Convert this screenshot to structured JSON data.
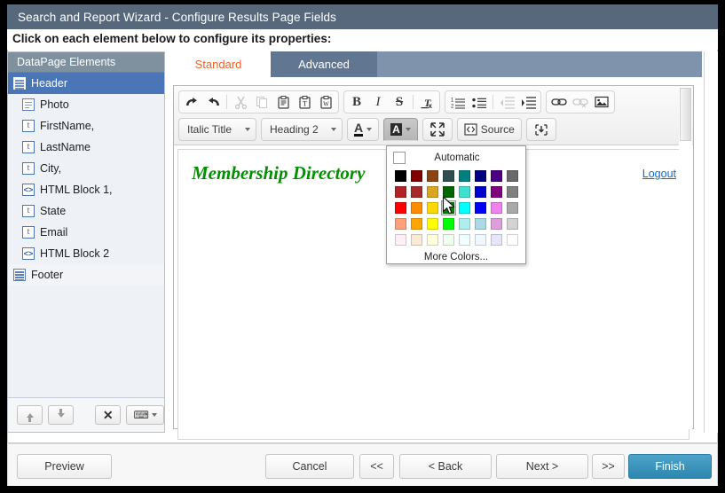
{
  "window": {
    "title": "Search and Report Wizard - Configure Results Page Fields",
    "instruction": "Click on each element below to configure its properties:"
  },
  "sidebar": {
    "header": "DataPage Elements",
    "items": [
      {
        "label": "Header",
        "icon": "block-icon",
        "level": 1,
        "selected": true
      },
      {
        "label": "Photo",
        "icon": "document-icon",
        "level": 2,
        "selected": false
      },
      {
        "label": "FirstName,",
        "icon": "text-field-icon",
        "level": 2,
        "selected": false
      },
      {
        "label": "LastName",
        "icon": "text-field-icon",
        "level": 2,
        "selected": false
      },
      {
        "label": "City,",
        "icon": "text-field-icon",
        "level": 2,
        "selected": false
      },
      {
        "label": "HTML Block 1,",
        "icon": "html-block-icon",
        "level": 2,
        "selected": false
      },
      {
        "label": "State",
        "icon": "text-field-icon",
        "level": 2,
        "selected": false
      },
      {
        "label": "Email",
        "icon": "text-field-icon",
        "level": 2,
        "selected": false
      },
      {
        "label": "HTML Block 2",
        "icon": "html-block-icon",
        "level": 2,
        "selected": false
      },
      {
        "label": "Footer",
        "icon": "block-icon",
        "level": 1,
        "selected": false,
        "footer": true
      }
    ],
    "tools": [
      {
        "name": "move-up-button",
        "glyph": "up"
      },
      {
        "name": "move-down-button",
        "glyph": "down"
      },
      {
        "name": "delete-element-button",
        "glyph": "✕"
      },
      {
        "name": "insert-element-dropdown",
        "glyph": "insert"
      }
    ]
  },
  "tabs": [
    {
      "label": "Standard",
      "active": true
    },
    {
      "label": "Advanced",
      "active": false
    }
  ],
  "editor": {
    "toolbar_row1": [
      {
        "group": 1,
        "name": "undo-icon",
        "glyph": "↶",
        "disabled": false
      },
      {
        "group": 1,
        "name": "redo-icon",
        "glyph": "↷",
        "disabled": false
      },
      {
        "group": 1,
        "name": "separator",
        "glyph": "|",
        "disabled": false
      },
      {
        "group": 1,
        "name": "cut-icon",
        "glyph": "✂",
        "disabled": true
      },
      {
        "group": 1,
        "name": "copy-icon",
        "glyph": "❐",
        "disabled": true
      },
      {
        "group": 1,
        "name": "paste-icon",
        "glyph": "Ὄb",
        "disabled": false
      },
      {
        "group": 1,
        "name": "paste-as-text-icon",
        "glyph": "T",
        "disabled": false
      },
      {
        "group": 1,
        "name": "paste-from-word-icon",
        "glyph": "W",
        "disabled": false
      },
      {
        "group": 2,
        "name": "bold-icon",
        "glyph": "B",
        "disabled": false
      },
      {
        "group": 2,
        "name": "italic-icon",
        "glyph": "I",
        "disabled": false
      },
      {
        "group": 2,
        "name": "strikethrough-icon",
        "glyph": "S",
        "disabled": false
      },
      {
        "group": 2,
        "name": "remove-format-icon",
        "glyph": "Tx",
        "disabled": false
      },
      {
        "group": 3,
        "name": "numbered-list-icon",
        "glyph": "1≡",
        "disabled": false
      },
      {
        "group": 3,
        "name": "bulleted-list-icon",
        "glyph": "•≡",
        "disabled": false
      },
      {
        "group": 3,
        "name": "decrease-indent-icon",
        "glyph": "←≡",
        "disabled": true
      },
      {
        "group": 3,
        "name": "increase-indent-icon",
        "glyph": "→≡",
        "disabled": false
      },
      {
        "group": 4,
        "name": "link-icon",
        "glyph": "⚭",
        "disabled": false
      },
      {
        "group": 4,
        "name": "unlink-icon",
        "glyph": "⚭",
        "disabled": true
      },
      {
        "group": 4,
        "name": "image-icon",
        "glyph": "⛰",
        "disabled": false
      }
    ],
    "style_select": "Italic Title",
    "format_select": "Heading 2",
    "text_color_label": "A",
    "bg_color_label": "A",
    "maximize_label": "",
    "source_label": "Source",
    "insert_label": "",
    "document": {
      "heading": "Membership Directory",
      "heading_color": "#009000",
      "logout_link": "Logout"
    }
  },
  "color_palette": {
    "automatic_label": "Automatic",
    "more_colors_label": "More Colors...",
    "selected_index": 19,
    "rows": [
      [
        "#000000",
        "#800000",
        "#8b4513",
        "#2f4f4f",
        "#008080",
        "#000080",
        "#4b0082",
        "#696969"
      ],
      [
        "#b22222",
        "#a52a2a",
        "#daa520",
        "#006400",
        "#40e0d0",
        "#0000cd",
        "#800080",
        "#808080"
      ],
      [
        "#ff0000",
        "#ff8c00",
        "#ffd700",
        "#008000",
        "#00ffff",
        "#0000ff",
        "#ee82ee",
        "#a9a9a9"
      ],
      [
        "#ffa07a",
        "#ffa500",
        "#ffff00",
        "#00ff00",
        "#afeeee",
        "#add8e6",
        "#dda0dd",
        "#d3d3d3"
      ],
      [
        "#fff0f5",
        "#faebd7",
        "#ffffe0",
        "#f0fff0",
        "#f0ffff",
        "#f0f8ff",
        "#e6e6fa",
        "#ffffff"
      ]
    ]
  },
  "footer": {
    "preview": "Preview",
    "cancel": "Cancel",
    "first": "<<",
    "back": "< Back",
    "next": "Next >",
    "last": ">>",
    "finish": "Finish"
  },
  "colors": {
    "titlebar": "#57687d",
    "tab_active_text": "#e8622a",
    "sidebar_selected": "#4a76b8",
    "finish_button": "#2d87b0",
    "link": "#1268c4"
  }
}
